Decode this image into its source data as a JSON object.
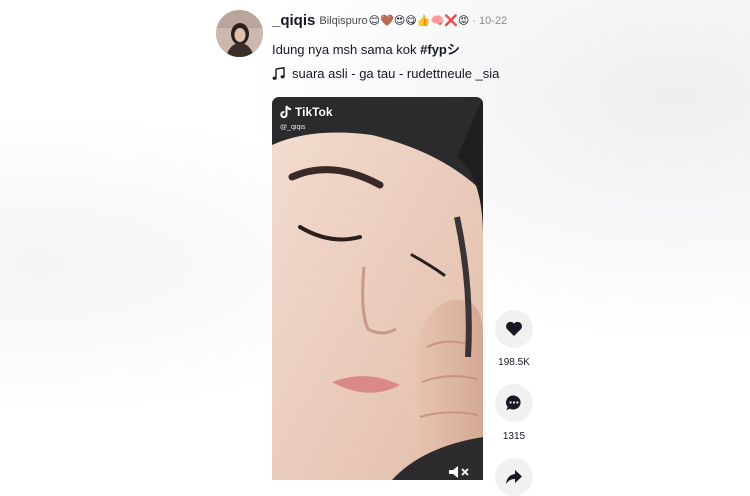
{
  "post": {
    "username": "_qiqis",
    "nickname": "Bilqispuro",
    "nickname_emojis": "😊🤎😍😋👍🧠❌😡",
    "separator": "·",
    "date": "10-22",
    "caption_text": "Idung nya msh sama kok ",
    "caption_hashtag": "#fypシ",
    "music_text": "suara asli - ga tau - rudettneule _sia"
  },
  "video": {
    "watermark_brand": "TikTok",
    "watermark_handle": "@_qiqis"
  },
  "actions": {
    "like_count": "198.5K",
    "comment_count": "1315"
  },
  "icons": {
    "like": "heart-icon",
    "comment": "comment-bubble-icon",
    "share": "share-arrow-icon",
    "music": "music-note-icon",
    "mute": "speaker-muted-icon"
  }
}
